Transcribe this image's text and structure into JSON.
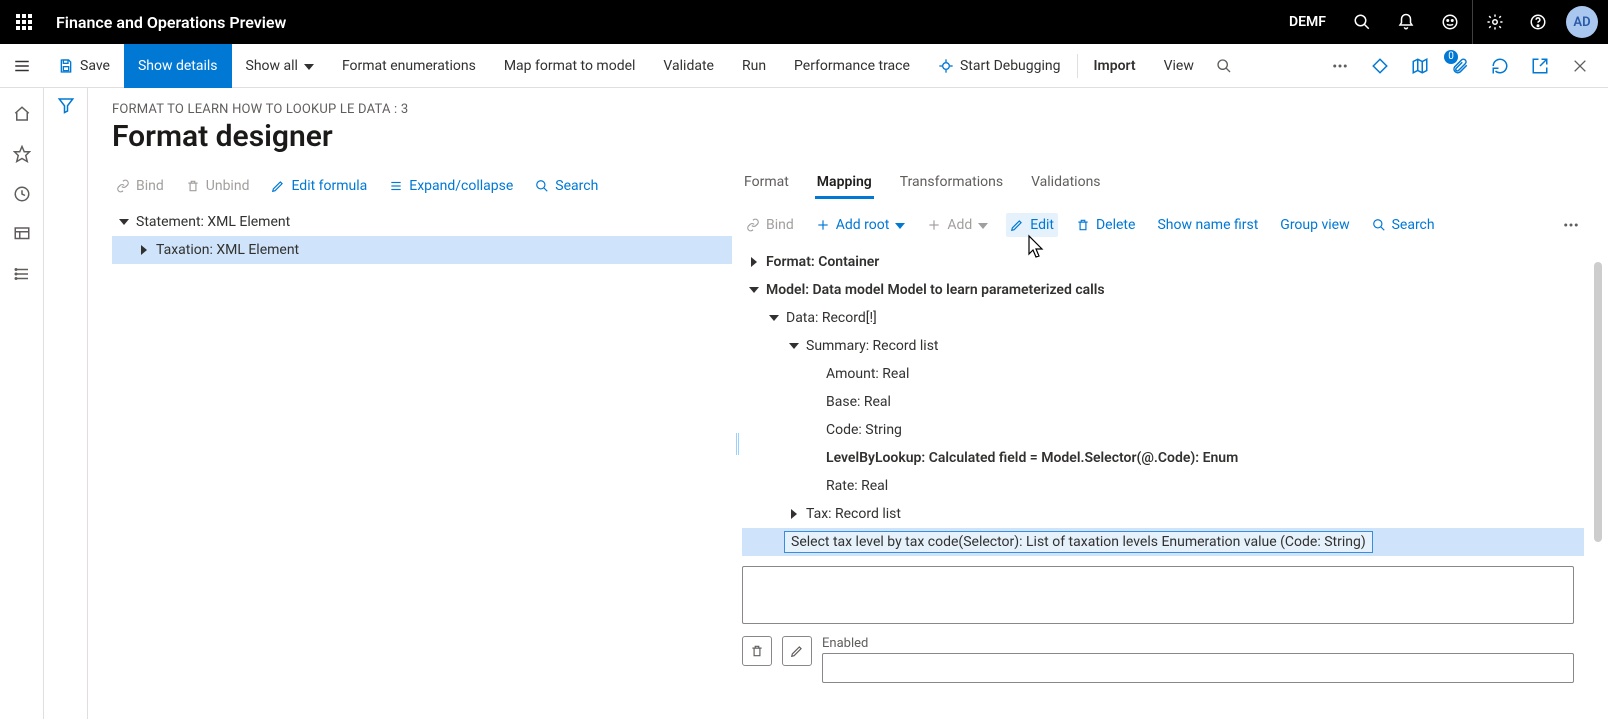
{
  "topbar": {
    "app_title": "Finance and Operations Preview",
    "company": "DEMF",
    "avatar_initials": "AD"
  },
  "cmdbar": {
    "save": "Save",
    "show_details": "Show details",
    "show_all": "Show all",
    "format_enums": "Format enumerations",
    "map_format": "Map format to model",
    "validate": "Validate",
    "run": "Run",
    "perf_trace": "Performance trace",
    "start_debug": "Start Debugging",
    "import": "Import",
    "view": "View",
    "badge0": "0"
  },
  "header": {
    "breadcrumb": "FORMAT TO LEARN HOW TO LOOKUP LE DATA : 3",
    "title": "Format designer"
  },
  "left_toolbar": {
    "bind": "Bind",
    "unbind": "Unbind",
    "edit_formula": "Edit formula",
    "expand": "Expand/collapse",
    "search": "Search"
  },
  "left_tree": {
    "row0": "Statement: XML Element",
    "row1": "Taxation: XML Element"
  },
  "tabs": {
    "format": "Format",
    "mapping": "Mapping",
    "transformations": "Transformations",
    "validations": "Validations"
  },
  "right_toolbar": {
    "bind": "Bind",
    "add_root": "Add root",
    "add": "Add",
    "edit": "Edit",
    "delete": "Delete",
    "show_name_first": "Show name first",
    "group_view": "Group view",
    "search": "Search"
  },
  "right_tree": {
    "r0": "Format: Container",
    "r1": "Model: Data model Model to learn parameterized calls",
    "r2": "Data: Record[!]",
    "r3": "Summary: Record list",
    "r4": "Amount: Real",
    "r5": "Base: Real",
    "r6": "Code: String",
    "r7": "LevelByLookup: Calculated field = Model.Selector(@.Code): Enum",
    "r8": "Rate: Real",
    "r9": "Tax: Record list",
    "r10": "Select tax level by tax code(Selector): List of taxation levels Enumeration value (Code: String)"
  },
  "bottom": {
    "enabled_label": "Enabled"
  }
}
